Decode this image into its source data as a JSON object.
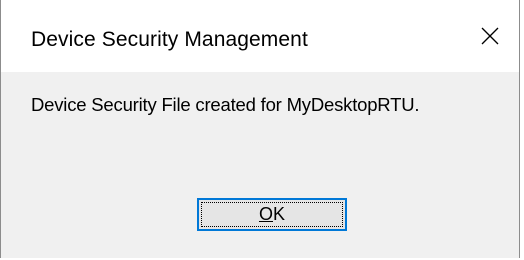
{
  "dialog": {
    "title": "Device Security Management",
    "close_icon": "close-icon",
    "message": "Device Security File created for MyDesktopRTU.",
    "ok_button": {
      "accelerator": "O",
      "rest": "K"
    }
  },
  "colors": {
    "title_bg": "#ffffff",
    "body_bg": "#f0f0f0",
    "button_border_focus": "#0078d7",
    "button_bg": "#e5e5e5"
  }
}
